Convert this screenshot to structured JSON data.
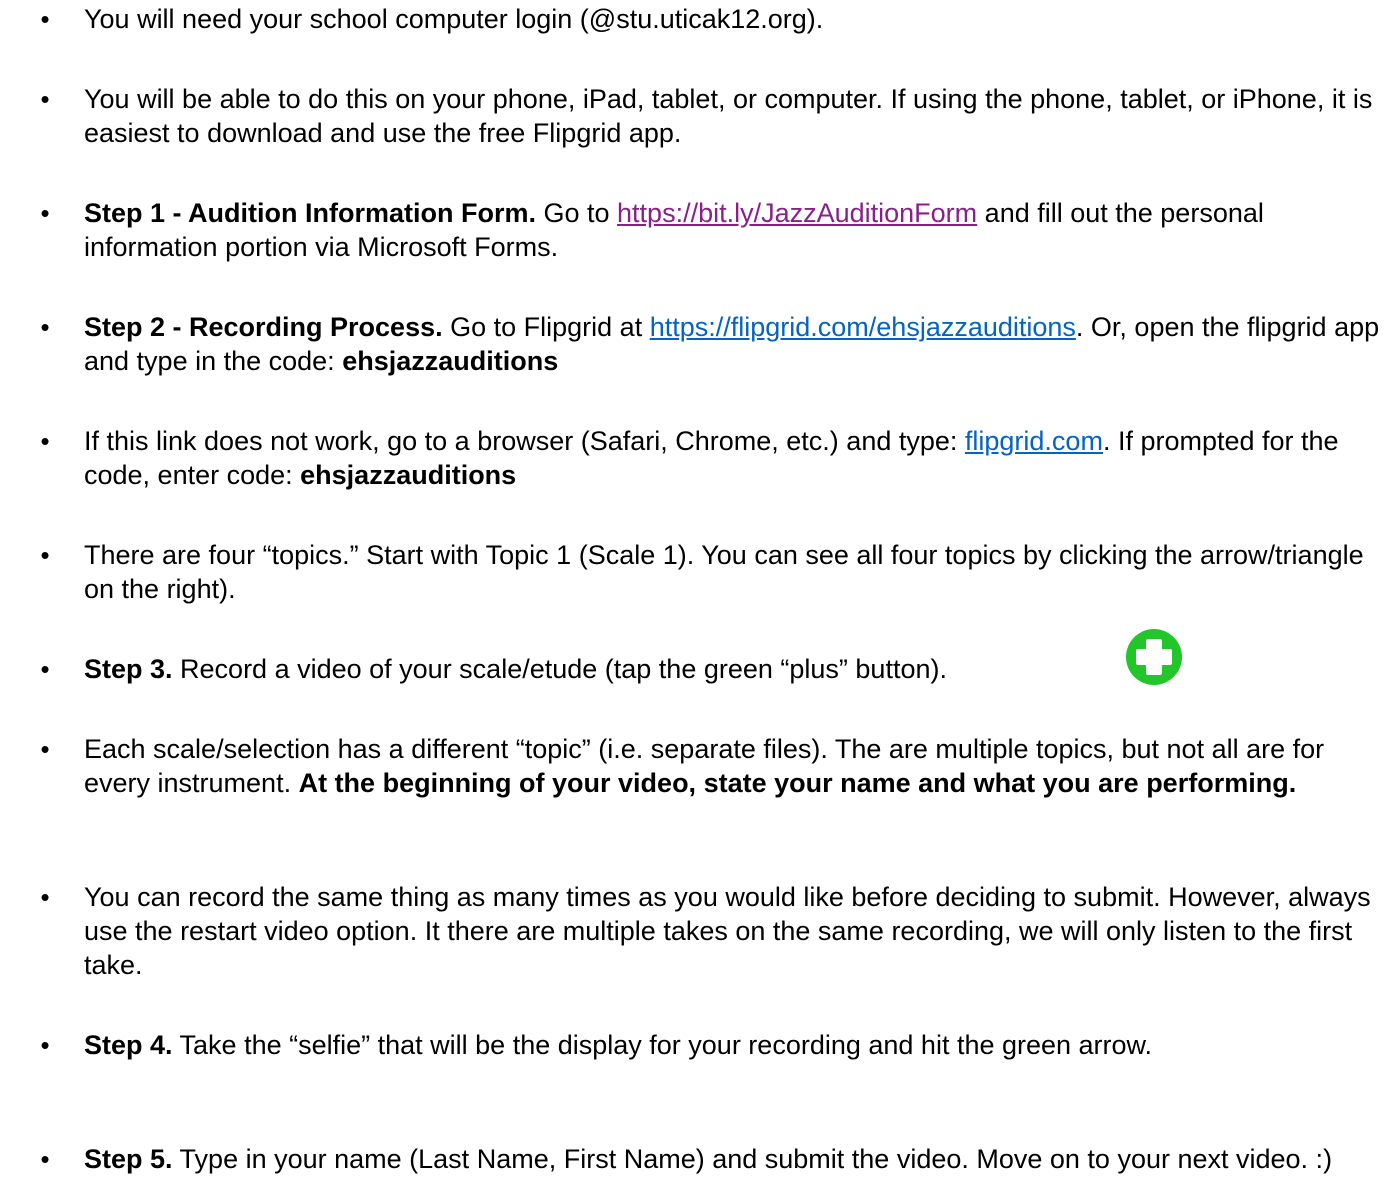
{
  "items": [
    {
      "plain": "You will need your school computer login (@stu.uticak12.org)."
    },
    {
      "plain": "You will be able to do this on your phone, iPad, tablet, or computer. If using the phone, tablet, or iPhone, it is easiest to download and use the free Flipgrid app."
    },
    {
      "bold": "Step 1 - Audition Information Form.",
      "pre": " Go to ",
      "link": "https://bit.ly/JazzAuditionForm",
      "post": " and fill out the personal information portion via Microsoft Forms."
    },
    {
      "bold": "Step 2 - Recording Process.",
      "pre": " Go to Flipgrid at ",
      "link": "https://flipgrid.com/ehsjazzauditions",
      "post": ". Or, open the flipgrid app and type in the code: ",
      "code": "ehsjazzauditions"
    },
    {
      "pre": "If this link does not work, go to a browser (Safari, Chrome, etc.) and type: ",
      "link": "flipgrid.com",
      "post": ". If prompted for the code, enter code: ",
      "code": "ehsjazzauditions"
    },
    {
      "plain": "There are four “topics.” Start with Topic 1 (Scale 1). You can see all four topics by clicking the arrow/triangle on the right)."
    },
    {
      "bold": "Step 3.",
      "plain": " Record a video of your scale/etude (tap the green “plus” button)."
    },
    {
      "plain": "Each scale/selection has a different “topic” (i.e. separate files). The are multiple topics, but not all are for every instrument. ",
      "bold_end": "At the beginning of your video, state your name and what you are performing."
    },
    {
      "plain": "You can record the same thing as many times as you would like before deciding to submit. However, always use the restart video option. It there are multiple takes on the same recording, we will only listen to the first take."
    },
    {
      "bold": "Step 4.",
      "plain": " Take the “selfie” that will be the display for your recording and hit the green arrow."
    },
    {
      "bold": "Step 5.",
      "plain": " Type in your name (Last Name, First Name) and submit the video. Move on to your next video. :)"
    }
  ],
  "bullet_glyph": "•",
  "colors": {
    "link": "#0563c1",
    "visited_link": "#8a1f8a",
    "plus_icon": "#22c62a"
  },
  "icons": {
    "plus": "plus-circle-icon"
  }
}
